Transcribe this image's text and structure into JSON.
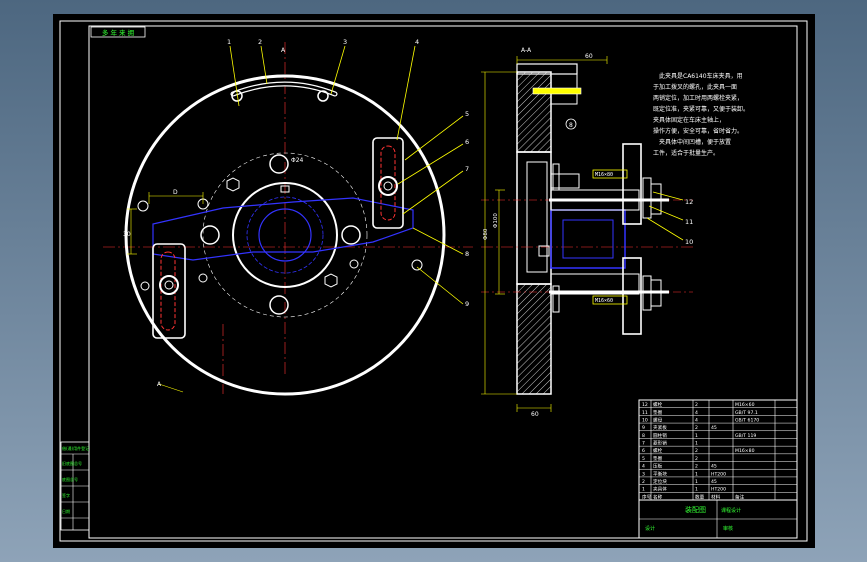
{
  "window": {
    "background_top": "#4d6780",
    "background_bottom": "#8ea3b8",
    "canvas_color": "#000000"
  },
  "colors": {
    "outline": "#ffffff",
    "hidden": "#3333ff",
    "center": "#ff3333",
    "leader": "#ffff00",
    "title_green": "#33ff33"
  },
  "drawing": {
    "corner_stamp": "多 年 来 拥",
    "section_label_left": "A",
    "section_label_top": "A-A",
    "part_numbers": {
      "n1": "1",
      "n2": "2",
      "n3": "3",
      "n4": "4",
      "n5": "5",
      "n6": "6",
      "n7": "7",
      "n8": "8",
      "n9": "9",
      "n10": "10",
      "n11": "11",
      "n12": "12"
    },
    "circle_mark": "8",
    "dim_top": "60",
    "dim_bottom": "60",
    "dim_left_a": "Φ80",
    "dim_left_b": "Φ100",
    "dim_small_left": "30",
    "dim_d": "D",
    "hole_label": "Φ24",
    "callout_upper": "M16×80",
    "callout_lower": "M16×60"
  },
  "notes": {
    "lines": [
      "此夹具是CA6140车床夹具，用",
      "于加工拨叉的螺孔，此夹具一面",
      "两销定位，加工时用两螺栓夹紧，",
      "既定位准，夹紧可靠，又便于装卸。",
      "夹具体固定在车床主轴上，",
      "操作方便，安全可靠，省时省力。",
      "夹具体中间凹槽，便于放置",
      "工件，适合于批量生产。"
    ]
  },
  "title_block": {
    "rows": [
      [
        "12",
        "螺栓",
        "2",
        "",
        "M16×60"
      ],
      [
        "11",
        "垫圈",
        "4",
        "",
        "GB/T 97.1"
      ],
      [
        "10",
        "螺母",
        "4",
        "",
        "GB/T 6170"
      ],
      [
        "9",
        "夹紧板",
        "2",
        "45",
        ""
      ],
      [
        "8",
        "圆柱销",
        "1",
        "",
        "GB/T 119"
      ],
      [
        "7",
        "菱形销",
        "1",
        "",
        ""
      ],
      [
        "6",
        "螺栓",
        "2",
        "",
        "M16×80"
      ],
      [
        "5",
        "垫圈",
        "2",
        "",
        ""
      ],
      [
        "4",
        "压板",
        "2",
        "45",
        ""
      ],
      [
        "3",
        "平衡块",
        "1",
        "HT200",
        ""
      ],
      [
        "2",
        "定位块",
        "1",
        "45",
        ""
      ],
      [
        "1",
        "夹具体",
        "1",
        "HT200",
        ""
      ]
    ],
    "header": [
      "序号",
      "名称",
      "数量",
      "材料",
      "备注"
    ],
    "drawing_title": "装配图",
    "school": "课程设计",
    "designer_label": "设计",
    "checker_label": "审核"
  },
  "left_strip": {
    "rows": [
      "借(通)用件登记",
      "旧底图总号",
      "底图总号",
      "签字",
      "日期"
    ]
  }
}
